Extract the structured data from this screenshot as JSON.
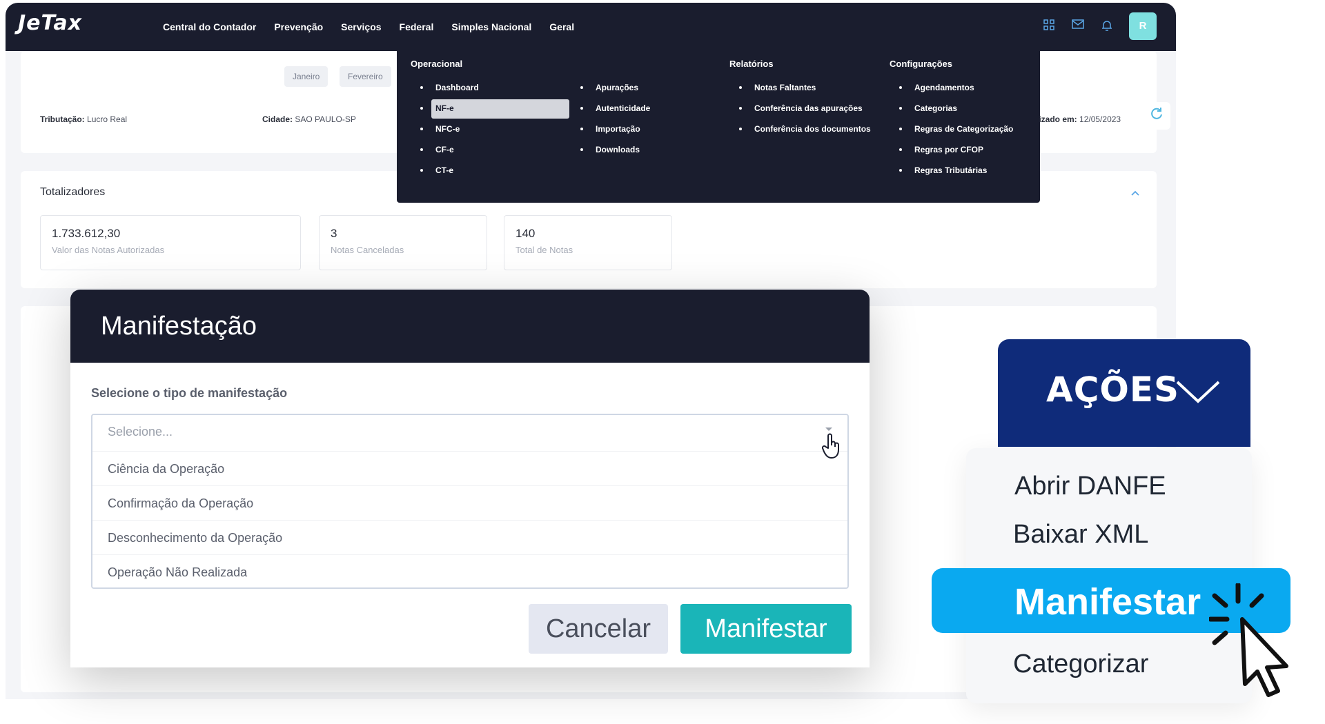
{
  "app": {
    "logo": "JeTax",
    "nav": [
      "Central do Contador",
      "Prevenção",
      "Serviços",
      "Federal",
      "Simples Nacional",
      "Geral"
    ],
    "nav_icons": [
      "grid-icon",
      "mail-icon",
      "bell-icon"
    ],
    "avatar_initial": "R"
  },
  "months": [
    "Janeiro",
    "Fevereiro"
  ],
  "company_info": {
    "tributacao_label": "Tributação:",
    "tributacao_value": "Lucro Real",
    "cidade_label": "Cidade:",
    "cidade_value": "SAO PAULO-SP",
    "atualizado_label": "lizado em:",
    "atualizado_value": "12/05/2023"
  },
  "mega_menu": {
    "col1_title": "Operacional",
    "col1_items": [
      "Dashboard",
      "NF-e",
      "NFC-e",
      "CF-e",
      "CT-e"
    ],
    "col2_items": [
      "Apurações",
      "Autenticidade",
      "Importação",
      "Downloads"
    ],
    "col3_title": "Relatórios",
    "col3_items": [
      "Notas Faltantes",
      "Conferência das apurações",
      "Conferência dos documentos"
    ],
    "col4_title": "Configurações",
    "col4_items": [
      "Agendamentos",
      "Categorias",
      "Regras de Categorização",
      "Regras por CFOP",
      "Regras Tributárias"
    ]
  },
  "totalizadores": {
    "title": "Totalizadores",
    "boxes": [
      {
        "value": "1.733.612,30",
        "label": "Valor das Notas Autorizadas"
      },
      {
        "value": "3",
        "label": "Notas Canceladas"
      },
      {
        "value": "140",
        "label": "Total de Notas"
      }
    ]
  },
  "modal": {
    "title": "Manifestação",
    "field_label": "Selecione o tipo de manifestação",
    "placeholder": "Selecione...",
    "options": [
      "Ciência da Operação",
      "Confirmação da Operação",
      "Desconhecimento da Operação",
      "Operação Não Realizada"
    ],
    "cancel_label": "Cancelar",
    "submit_label": "Manifestar"
  },
  "actions": {
    "header": "AÇÕES",
    "items": [
      "Abrir DANFE",
      "Baixar XML",
      "Manifestar",
      "Categorizar"
    ],
    "highlight_color": "#0aa9f0",
    "header_color": "#0f2b7a"
  }
}
